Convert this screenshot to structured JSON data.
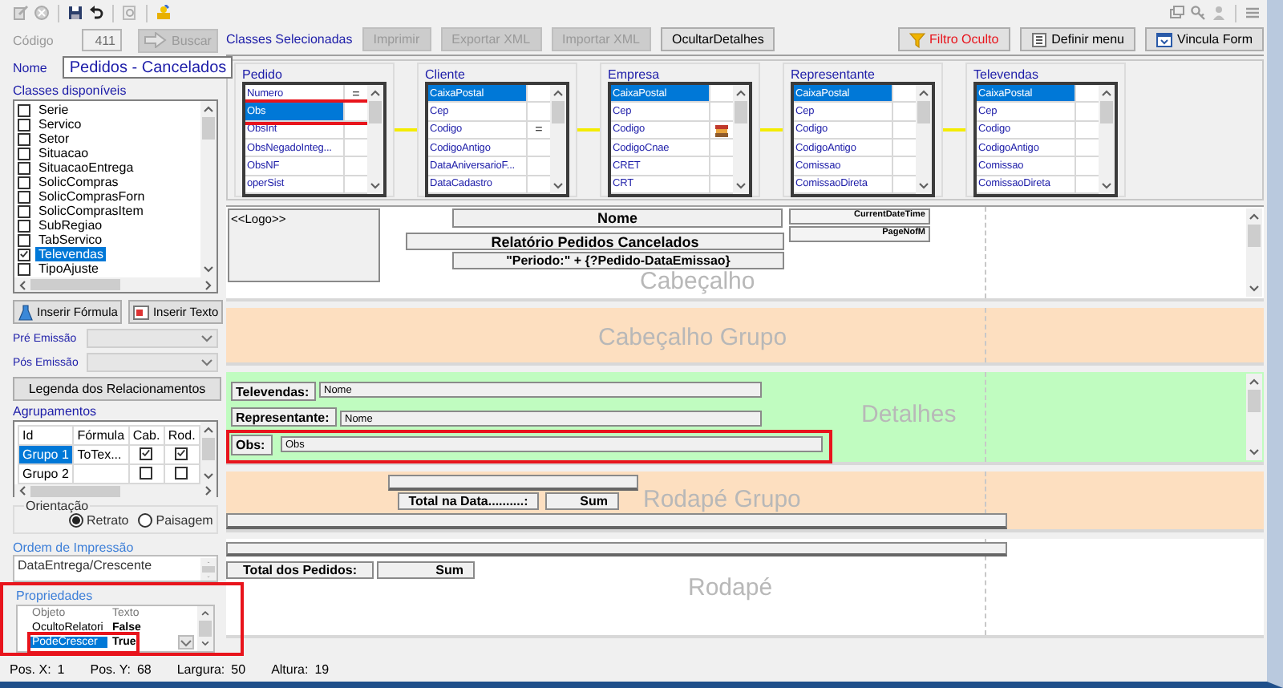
{
  "code_field": {
    "label": "Código",
    "value": "411",
    "disabled": true
  },
  "search_button": {
    "label": "Buscar",
    "disabled": true
  },
  "name_field": {
    "label": "Nome",
    "value": "Pedidos - Cancelados"
  },
  "available_classes": {
    "title": "Classes disponíveis",
    "items": [
      {
        "label": "Serie",
        "checked": false,
        "selected": false
      },
      {
        "label": "Servico",
        "checked": false,
        "selected": false
      },
      {
        "label": "Setor",
        "checked": false,
        "selected": false
      },
      {
        "label": "Situacao",
        "checked": false,
        "selected": false
      },
      {
        "label": "SituacaoEntrega",
        "checked": false,
        "selected": false
      },
      {
        "label": "SolicCompras",
        "checked": false,
        "selected": false
      },
      {
        "label": "SolicComprasForn",
        "checked": false,
        "selected": false
      },
      {
        "label": "SolicComprasItem",
        "checked": false,
        "selected": false
      },
      {
        "label": "SubRegiao",
        "checked": false,
        "selected": false
      },
      {
        "label": "TabServico",
        "checked": false,
        "selected": false
      },
      {
        "label": "Televendas",
        "checked": true,
        "selected": true
      },
      {
        "label": "TipoAjuste",
        "checked": false,
        "selected": false
      }
    ]
  },
  "insert_buttons": [
    {
      "label": "Inserir Fórmula",
      "kind": "formula"
    },
    {
      "label": "Inserir Texto",
      "kind": "text"
    }
  ],
  "emission_selects": [
    {
      "label": "Pré Emissão"
    },
    {
      "label": "Pós Emissão"
    }
  ],
  "legend_button": {
    "label": "Legenda dos Relacionamentos"
  },
  "groupings": {
    "title": "Agrupamentos",
    "columns": [
      "Id",
      "Fórmula",
      "Cab.",
      "Rod."
    ],
    "rows": [
      {
        "id": "Grupo 1",
        "formula": "ToTex...",
        "header": true,
        "footer": true,
        "selected": true
      },
      {
        "id": "Grupo 2",
        "header": false,
        "footer": false,
        "selected": false
      }
    ]
  },
  "orientation": {
    "title": "Orientação",
    "options": [
      {
        "label": "Retrato",
        "selected": true
      },
      {
        "label": "Paisagem",
        "selected": false
      }
    ]
  },
  "print_order": {
    "title": "Ordem de Impressão",
    "value": "DataEntrega/Crescente"
  },
  "properties": {
    "title": "Propriedades",
    "highlighted": true,
    "columns": [
      "Objeto",
      "Texto"
    ],
    "rows": [
      {
        "name": "OcultoRelatori",
        "value": "False",
        "selected": false,
        "highlighted": false
      },
      {
        "name": "PodeCrescer",
        "value": "True",
        "selected": true,
        "highlighted": true
      }
    ]
  },
  "selected_classes_title": "Classes Selecionadas",
  "actions": [
    {
      "label": "Imprimir",
      "disabled": true
    },
    {
      "label": "Exportar XML",
      "disabled": true
    },
    {
      "label": "Importar XML",
      "disabled": true
    },
    {
      "label": "OcultarDetalhes",
      "disabled": false
    }
  ],
  "tools": [
    {
      "label": "Filtro Oculto",
      "kind": "filter"
    },
    {
      "label": "Definir menu",
      "kind": "menu"
    },
    {
      "label": "Vincula Form",
      "kind": "form"
    }
  ],
  "classes": [
    {
      "title": "Pedido",
      "fields": [
        {
          "name": "Numero",
          "marker": "=",
          "selected": false,
          "highlighted": false
        },
        {
          "name": "Obs",
          "selected": true,
          "highlighted": true
        },
        {
          "name": "ObsInt",
          "selected": false,
          "highlighted": false
        },
        {
          "name": "ObsNegadoInteg...",
          "selected": false,
          "highlighted": false
        },
        {
          "name": "ObsNF",
          "selected": false,
          "highlighted": false
        },
        {
          "name": "operSist",
          "selected": false,
          "highlighted": false
        }
      ]
    },
    {
      "title": "Cliente",
      "fields": [
        {
          "name": "CaixaPostal",
          "selected": true
        },
        {
          "name": "Cep",
          "selected": false
        },
        {
          "name": "Codigo",
          "marker": "=",
          "selected": false
        },
        {
          "name": "CodigoAntigo",
          "selected": false
        },
        {
          "name": "DataAniversarioF...",
          "selected": false
        },
        {
          "name": "DataCadastro",
          "selected": false
        }
      ]
    },
    {
      "title": "Empresa",
      "fields": [
        {
          "name": "CaixaPostal",
          "selected": true
        },
        {
          "name": "Cep",
          "selected": false
        },
        {
          "name": "Codigo",
          "has_icon": true,
          "selected": false
        },
        {
          "name": "CodigoCnae",
          "selected": false
        },
        {
          "name": "CRET",
          "selected": false
        },
        {
          "name": "CRT",
          "selected": false
        }
      ]
    },
    {
      "title": "Representante",
      "fields": [
        {
          "name": "CaixaPostal",
          "selected": true
        },
        {
          "name": "Cep",
          "selected": false
        },
        {
          "name": "Codigo",
          "selected": false
        },
        {
          "name": "CodigoAntigo",
          "selected": false
        },
        {
          "name": "Comissao",
          "selected": false
        },
        {
          "name": "ComissaoDireta",
          "selected": false
        }
      ]
    },
    {
      "title": "Televendas",
      "fields": [
        {
          "name": "CaixaPostal",
          "selected": true
        },
        {
          "name": "Cep",
          "selected": false
        },
        {
          "name": "Codigo",
          "selected": false
        },
        {
          "name": "CodigoAntigo",
          "selected": false
        },
        {
          "name": "Comissao",
          "selected": false
        },
        {
          "name": "ComissaoDireta",
          "selected": false
        }
      ]
    }
  ],
  "bands": [
    {
      "kind": "header",
      "label": "Cabeçalho",
      "items": [
        {
          "kind": "logo",
          "text": "<<Logo>>"
        },
        {
          "kind": "title",
          "text": "Nome"
        },
        {
          "kind": "small",
          "text": "CurrentDateTime"
        },
        {
          "kind": "small",
          "text": "PageNofM"
        },
        {
          "kind": "title",
          "text": "Relatório Pedidos Cancelados"
        },
        {
          "kind": "text",
          "text": "\"Periodo:\" + {?Pedido-DataEmissao}"
        }
      ]
    },
    {
      "kind": "group_header",
      "label": "Cabeçalho Grupo"
    },
    {
      "kind": "detail",
      "label": "Detalhes",
      "rows": [
        {
          "label": "Televendas:",
          "field": "Nome"
        },
        {
          "label": "Representante:",
          "field": "Nome"
        },
        {
          "label": "Obs:",
          "field": "Obs",
          "highlighted": true
        }
      ]
    },
    {
      "kind": "group_footer",
      "label": "Rodapé Grupo",
      "items": [
        {
          "kind": "line"
        },
        {
          "kind": "text",
          "text": "Total na Data..........:"
        },
        {
          "kind": "sum",
          "text": "Sum"
        },
        {
          "kind": "line"
        }
      ]
    },
    {
      "kind": "footer",
      "label": "Rodapé",
      "items": [
        {
          "kind": "line"
        },
        {
          "kind": "text",
          "text": "Total dos Pedidos:"
        },
        {
          "kind": "sum",
          "text": "Sum"
        }
      ]
    }
  ],
  "status_bar": [
    {
      "label": "Pos. X:",
      "value": "1"
    },
    {
      "label": "Pos. Y:",
      "value": "68"
    },
    {
      "label": "Largura:",
      "value": "50"
    },
    {
      "label": "Altura:",
      "value": "19"
    }
  ]
}
